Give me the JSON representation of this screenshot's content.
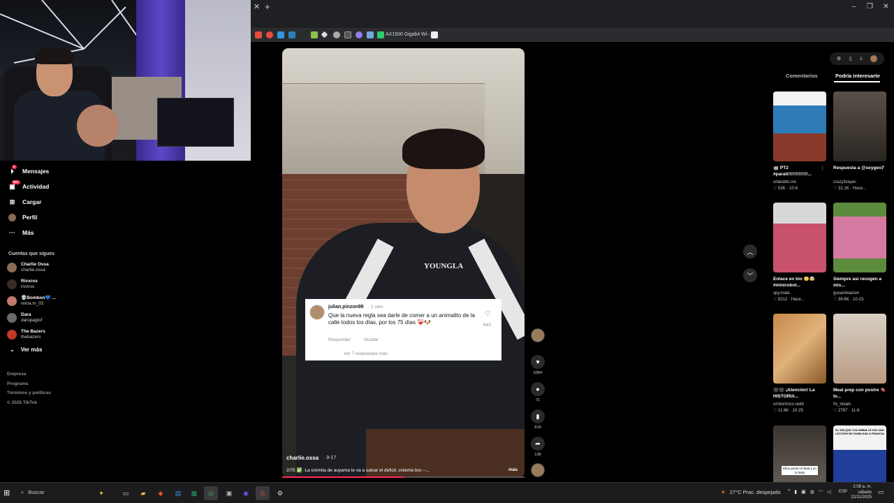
{
  "browser": {
    "new_tab_glyph": "+",
    "close_glyph": "✕",
    "bookmark_label": "AX1500 Gigabit Wi-...",
    "window_controls": [
      "–",
      "❐",
      "✕"
    ]
  },
  "sidebar": {
    "items": [
      {
        "label": "Mensajes",
        "icon": "send-icon",
        "badge": "1"
      },
      {
        "label": "Actividad",
        "icon": "inbox-icon",
        "badge": "99+"
      },
      {
        "label": "Cargar",
        "icon": "upload-icon",
        "badge": ""
      },
      {
        "label": "Perfil",
        "icon": "profile-avatar-icon",
        "badge": ""
      },
      {
        "label": "Más",
        "icon": "more-icon",
        "badge": ""
      }
    ],
    "following_title": "Cuentas que sigues",
    "accounts": [
      {
        "name": "Charlie Ossa",
        "username": "charlie.ossa",
        "color": "#8a6b52"
      },
      {
        "name": "Rivxros",
        "username": "rivxros",
        "color": "#3a2b2b"
      },
      {
        "name": "💀Bombon💙 ...",
        "username": "reina.m_02",
        "color": "#c47a6a"
      },
      {
        "name": "Dara",
        "username": "darspaglof",
        "color": "#6a6a6a"
      },
      {
        "name": "The Bazers",
        "username": "thebazers",
        "color": "#c0392b"
      }
    ],
    "see_more": "Ver más",
    "footer": [
      "Empresa",
      "Programa",
      "Términos y políticas",
      "© 2025 TikTok"
    ]
  },
  "video": {
    "author": "charlie.ossa",
    "date": "· 9-17",
    "caption": "2/75 ✅ -La cremita de auyama te va a salvar el deficit, créeme bro --...",
    "more_label": "más",
    "progress": 0.5,
    "shirt_logo": "YOUNGLA"
  },
  "comment": {
    "user": "julian.pinzon98",
    "time": "1 sem",
    "text": "Que la nueva regla sea darle de comer a un animalito de la calle todos los días, por los 75 días ❤️‍🩹🐶",
    "likes": "843",
    "reply": "Responder",
    "hide": "Ocultar",
    "view_replies": "Ver 7 respuestas más"
  },
  "actions": {
    "likes": "5354",
    "comments": "71",
    "saves": "619",
    "shares": "139"
  },
  "right_panel": {
    "tabs": [
      "Comentarios",
      "Podría interesarte"
    ],
    "active_tab": "Podría interesarte",
    "cards": [
      {
        "title": "🤖 PT2 #parati!!!!!!!!!!!!!...",
        "author": "orlanddo.mx",
        "stats": "♡ 53K · 10-6",
        "bg": "linear-gradient(180deg,#f2f2f2 0 20%,#2e7bb8 20% 60%,#8a3a2a 60% 100%)"
      },
      {
        "title": "Respuesta a @soygeo7",
        "author": "crazy3rayan",
        "stats": "♡ 32.1K · Hace...",
        "bg": "linear-gradient(180deg,#5a5048,#2a2622)"
      },
      {
        "title": "Enlace en bio 😳🤯 #minirobot...",
        "author": "spy.mate",
        "stats": "♡ 8212 · Hace...",
        "bg": "linear-gradient(180deg,#d8d8d8 0 30%,#c8516e 30% 100%)"
      },
      {
        "title": "Siempre así recogen a mis...",
        "author": "gusanimacion",
        "stats": "♡ 39.6K · 10-23",
        "bg": "linear-gradient(180deg,#5c8b3e 0 20%,#d47aa0 20% 80%,#5c8b3e 80%)"
      },
      {
        "title": "⚫⚫ ¡Atención! La HISTORIA...",
        "author": "ornitorrinco.redd",
        "stats": "♡ 11.6K · 10-25",
        "bg": "linear-gradient(135deg,#c8884a,#e0b27a,#8a5a2a)"
      },
      {
        "title": "Meal prep con postre 🍫 lo...",
        "author": "fix_meals",
        "stats": "♡ 2767 · 11-8",
        "bg": "linear-gradient(180deg,#d8cfc4,#b89b84)"
      },
      {
        "title": "",
        "author": "",
        "stats": "",
        "bg": "linear-gradient(180deg,#3a3430,#6a625a)"
      },
      {
        "title": "",
        "author": "",
        "stats": "",
        "bg": "linear-gradient(180deg,#f2f2f2 0 35%,#1f3f9a 35%)"
      }
    ],
    "card_texts": [
      "Ellos ponen el beat y yo lo bailo",
      "EL DÍA QUE COLOMBIA LE DIÓ UNA LECCIÓN DE HUMILDAD A FRANCIA"
    ]
  },
  "taskbar": {
    "search": "Buscar",
    "weather": "27°C  Prac. despejado",
    "lang": "ESP",
    "time": "2:08 a. m.",
    "day": "sábado",
    "date": "22/11/2025"
  }
}
